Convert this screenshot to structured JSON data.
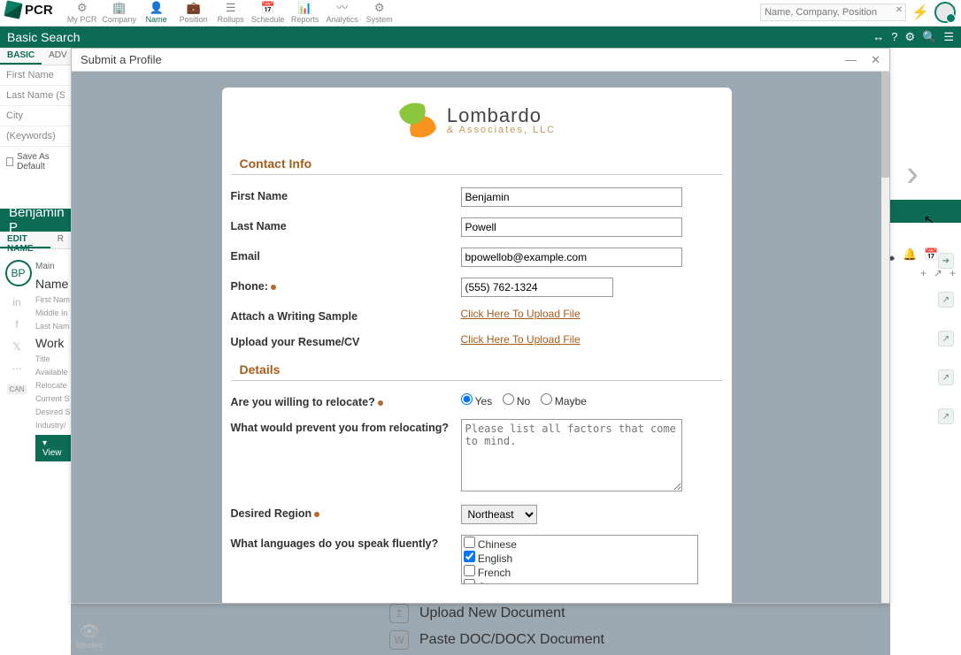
{
  "brand": "PCR",
  "nav": {
    "items": [
      {
        "icon": "⚙",
        "label": "My PCR"
      },
      {
        "icon": "🏢",
        "label": "Company"
      },
      {
        "icon": "👤",
        "label": "Name",
        "active": true
      },
      {
        "icon": "💼",
        "label": "Position"
      },
      {
        "icon": "☰",
        "label": "Rollups"
      },
      {
        "icon": "📅",
        "label": "Schedule"
      },
      {
        "icon": "📊",
        "label": "Reports"
      },
      {
        "icon": "〰",
        "label": "Analytics"
      },
      {
        "icon": "⚙",
        "label": "System"
      }
    ],
    "search_placeholder": "Name, Company, Position"
  },
  "greenbar": {
    "title": "Basic Search",
    "icons": [
      "↔",
      "?",
      "⚙",
      "🔍",
      "☰"
    ]
  },
  "searchtabs": {
    "basic": "BASIC",
    "adv": "ADV"
  },
  "srch_fields": {
    "first": "First Name",
    "last": "Last Name (Sort)",
    "city": "City",
    "kw": "(Keywords)"
  },
  "save_default": "Save As Default",
  "name_header": "Benjamin P",
  "nametabs": {
    "edit": "EDIT NAME",
    "r": "R"
  },
  "bp_initials": "BP",
  "bp_main": "Main",
  "leftfields": {
    "name_sec": "Name",
    "first": "First Nam",
    "mi": "Middle In",
    "last": "Last Nam",
    "work_sec": "Work",
    "title": "Title",
    "avail": "Available",
    "reloc": "Relocate",
    "cur": "Current S",
    "des": "Desired S",
    "ind": "Industry/"
  },
  "viewbar": "▾  View",
  "rightrail_header": [
    "📞",
    "🔔",
    "📅",
    "☰"
  ],
  "rightrail_plus": [
    "+",
    "↗",
    "+"
  ],
  "rightrail_icons": [
    "➜",
    "↗",
    "↗",
    "↗",
    "↗"
  ],
  "modal": {
    "title": "Submit a Profile",
    "logo": {
      "l1": "Lombardo",
      "l2": "& Associates, LLC"
    },
    "sec_contact": "Contact Info",
    "sec_details": "Details",
    "labels": {
      "first": "First Name",
      "last": "Last Name",
      "email": "Email",
      "phone": "Phone:",
      "ws": "Attach a Writing Sample",
      "cv": "Upload your Resume/CV",
      "relocq": "Are you willing to relocate?",
      "prevent": "What would prevent you from relocating?",
      "region": "Desired Region",
      "langs": "What languages do you speak fluently?"
    },
    "values": {
      "first": "Benjamin",
      "last": "Powell",
      "email": "bpowellob@example.com",
      "phone": "(555) 762-1324",
      "upload_link": "Click Here To Upload File",
      "prevent_ph": "Please list all factors that come to mind.",
      "region_sel": "Northeast"
    },
    "relocate_opts": {
      "yes": "Yes",
      "no": "No",
      "maybe": "Maybe",
      "selected": "yes"
    },
    "langs": [
      {
        "label": "Chinese",
        "checked": false
      },
      {
        "label": "English",
        "checked": true
      },
      {
        "label": "French",
        "checked": false
      },
      {
        "label": "German",
        "checked": false
      }
    ]
  },
  "bottom": {
    "upload": "Upload New Document",
    "paste": "Paste DOC/DOCX Document",
    "blinded": "Blinded"
  }
}
